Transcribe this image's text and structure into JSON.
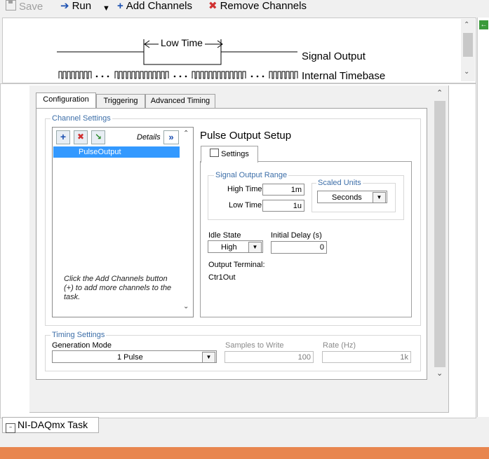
{
  "toolbar": {
    "save": "Save",
    "run": "Run",
    "add_channels": "Add Channels",
    "remove_channels": "Remove Channels"
  },
  "diagram": {
    "low_time": "Low Time",
    "signal_output": "Signal Output",
    "internal_timebase": "Internal Timebase"
  },
  "tabs": [
    {
      "label": "Configuration"
    },
    {
      "label": "Triggering"
    },
    {
      "label": "Advanced Timing"
    }
  ],
  "channel_settings": {
    "title": "Channel Settings",
    "details_label": "Details",
    "channels": [
      "PulseOutput"
    ],
    "hint": "Click the Add Channels button (+) to add more channels to the task."
  },
  "pulse_setup": {
    "title": "Pulse Output Setup",
    "settings_tab": "Settings",
    "signal_output_range": "Signal Output Range",
    "high_time_label": "High Time",
    "high_time_value": "1m",
    "low_time_label": "Low Time",
    "low_time_value": "1u",
    "scaled_units_label": "Scaled Units",
    "scaled_units_value": "Seconds",
    "idle_state_label": "Idle State",
    "idle_state_value": "High",
    "initial_delay_label": "Initial Delay (s)",
    "initial_delay_value": "0",
    "output_terminal_label": "Output Terminal:",
    "output_terminal_value": "Ctr1Out"
  },
  "timing_settings": {
    "title": "Timing Settings",
    "generation_mode_label": "Generation Mode",
    "generation_mode_value": "1 Pulse",
    "samples_label": "Samples to Write",
    "samples_value": "100",
    "rate_label": "Rate (Hz)",
    "rate_value": "1k"
  },
  "status": {
    "task_tab": "NI-DAQmx Task"
  },
  "colors": {
    "accent_blue": "#3c6ea8",
    "selection": "#3399ff",
    "bottom_bar": "#e8864f"
  }
}
